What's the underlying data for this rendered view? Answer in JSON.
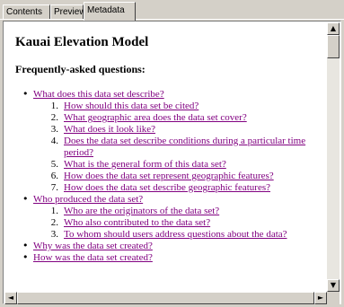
{
  "tabs": [
    "Contents",
    "Preview",
    "Metadata"
  ],
  "active_tab": "Metadata",
  "document": {
    "title": "Kauai Elevation Model",
    "subtitle": "Frequently-asked questions:",
    "faq": [
      {
        "question": "What does this data set describe?",
        "sub": [
          "How should this data set be cited?",
          "What geographic area does the data set cover?",
          "What does it look like?",
          "Does the data set describe conditions during a particular time period?",
          "What is the general form of this data set?",
          "How does the data set represent geographic features?",
          "How does the data set describe geographic features?"
        ]
      },
      {
        "question": "Who produced the data set?",
        "sub": [
          "Who are the originators of the data set?",
          "Who also contributed to the data set?",
          "To whom should users address questions about the data?"
        ]
      },
      {
        "question": "Why was the data set created?",
        "sub": []
      },
      {
        "question": "How was the data set created?",
        "sub": []
      }
    ]
  },
  "scrollbar_icons": {
    "up": "▲",
    "down": "▼",
    "left": "◄",
    "right": "►"
  },
  "colors": {
    "link": "#800080",
    "window": "#d4d0c8"
  }
}
